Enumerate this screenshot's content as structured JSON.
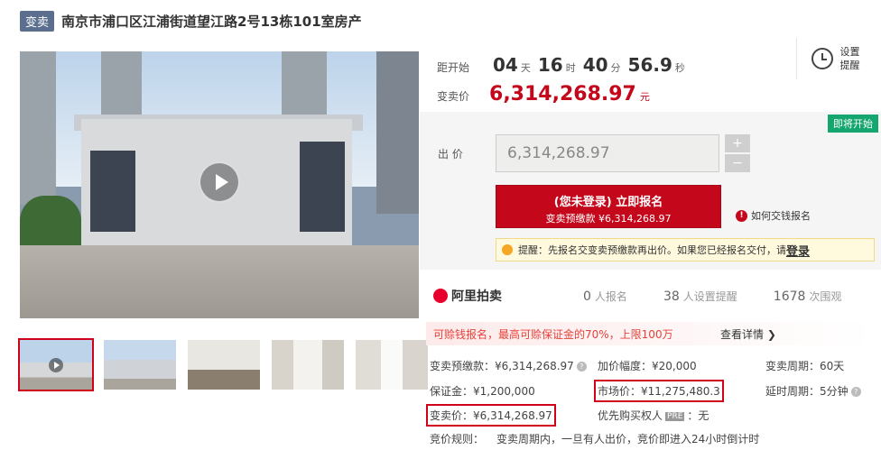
{
  "header": {
    "tag": "变卖",
    "title": "南京市浦口区江浦街道望江路2号13栋101室房产"
  },
  "countdown": {
    "label": "距开始",
    "days": "04",
    "days_unit": "天",
    "hours": "16",
    "hours_unit": "时",
    "minutes": "40",
    "minutes_unit": "分",
    "seconds": "56.9",
    "seconds_unit": "秒"
  },
  "price": {
    "label": "变卖价",
    "value": "6,314,268.97",
    "unit": "元"
  },
  "remind": {
    "label": "设置提醒",
    "icon": "alarm-clock-icon"
  },
  "bid": {
    "status_badge": "即将开始",
    "label": "出 价",
    "input_value": "6,314,268.97",
    "plus": "+",
    "minus": "−",
    "signup_main": "(您未登录) 立即报名",
    "signup_sub": "变卖预缴款 ¥6,314,268.97",
    "howto_icon": "!",
    "howto": "如何交钱报名",
    "tip_text": "提醒：先报名交变卖预缴款再出价。如果您已经报名交付，请",
    "tip_login": "登录"
  },
  "stats": {
    "brand": "阿里拍卖",
    "signups": "0",
    "signups_label": "人报名",
    "reminders": "38",
    "reminders_label": "人设置提醒",
    "views": "1678",
    "views_label": "次围观"
  },
  "notice": {
    "text": "可赊钱报名，最高可赊保证金的70%，上限100万",
    "link": "查看详情 ❯"
  },
  "details": {
    "deposit": "变卖预缴款：¥6,314,268.97",
    "increment": "加价幅度：¥20,000",
    "period": "变卖周期：60天",
    "bond": "保证金：¥1,200,000",
    "market_price": "市场价：¥11,275,480.3",
    "delay": "延时周期：5分钟",
    "sell_price": "变卖价：¥6,314,268.97",
    "priority_pre": "优先购买权人",
    "priority_badge": "PRE",
    "priority_post": "：无",
    "rule_label": "竞价规则：",
    "rule": "变卖周期内，一旦有人出价，竞价即进入24小时倒计时"
  },
  "colors": {
    "accent": "#c4071b",
    "tag_bg": "#5b6e8e",
    "badge_green": "#14a66e"
  }
}
